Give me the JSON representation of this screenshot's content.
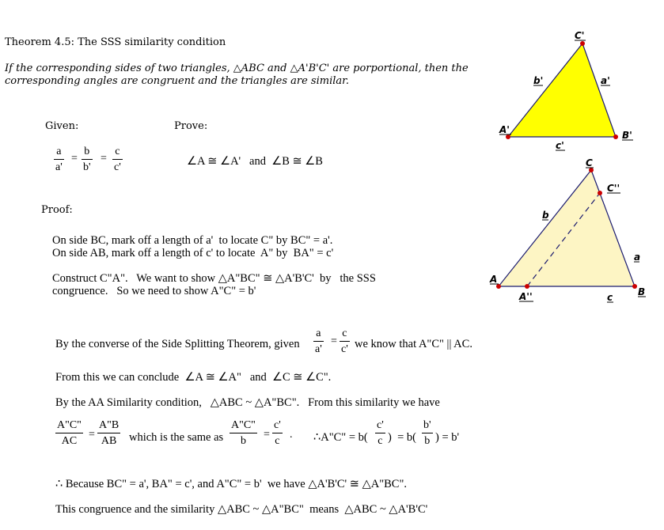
{
  "theorem": {
    "title": "Theorem 4.5: The SSS similarity condition",
    "statement_line1": "If the corresponding sides of two triangles, △ABC  and △A'B'C'  are porportional, then the",
    "statement_line2": "corresponding angles are congruent and the triangles are similar."
  },
  "given": {
    "label": "Given:",
    "fractions": [
      {
        "num": "a",
        "den": "a'"
      },
      {
        "num": "b",
        "den": "b'"
      },
      {
        "num": "c",
        "den": "c'"
      }
    ],
    "eq": "="
  },
  "prove": {
    "label": "Prove:",
    "statement": "∠A ≅ ∠A'   and  ∠B ≅ ∠B"
  },
  "proof": {
    "label": "Proof:",
    "line1": "On side BC, mark off a length of a'  to locate C\" by BC\" = a'.",
    "line2": "On side AB, mark off a length of c' to locate  A\" by  BA\" = c'",
    "line3": "Construct C\"A\".   We want to show △A\"BC\" ≅ △A'B'C'  by   the SSS",
    "line4": "congruence.   So we need to show A\"C\" = b'",
    "line5_pre": "By the converse of the Side Splitting Theorem, given",
    "line5_frac1": {
      "num": "a",
      "den": "a'"
    },
    "line5_frac2": {
      "num": "c",
      "den": "c'"
    },
    "line5_post": "we know that A\"C\" || AC.",
    "line6": "From this we can conclude  ∠A ≅ ∠A\"   and  ∠C ≅ ∠C\".",
    "line7": "By the AA Similarity condition,   △ABC ~ △A\"BC\".   From this similarity we have",
    "line8": {
      "frac1": {
        "num": "A\"C\"",
        "den": "AC"
      },
      "frac2": {
        "num": "A\"B",
        "den": "AB"
      },
      "mid_text": "which is the same as",
      "frac3": {
        "num": "A\"C\"",
        "den": "b"
      },
      "frac4": {
        "num": "c'",
        "den": "c"
      },
      "period": ".",
      "therefore_pre": "∴A\"C\" = b(",
      "frac5": {
        "num": "c'",
        "den": "c"
      },
      "mid2": ")  = b(",
      "frac6": {
        "num": "b'",
        "den": "b"
      },
      "end": ") = b'"
    },
    "line9": "∴ Because BC\" = a', BA\" = c', and A\"C\" = b'  we have △A'B'C' ≅ △A\"BC\".",
    "line10": "This congruence and the similarity △ABC ~ △A\"BC\"  means  △ABC ~ △A'B'C'"
  },
  "figure1": {
    "fill": "#ffff00",
    "stroke": "#1a1a6e",
    "point_color": "#cc0000",
    "labels": {
      "A": "A'",
      "B": "B'",
      "C": "C'",
      "a": "a'",
      "b": "b'",
      "c": "c'"
    }
  },
  "figure2": {
    "fill": "#fdf5c4",
    "stroke": "#1a1a6e",
    "point_color": "#cc0000",
    "labels": {
      "A": "A",
      "B": "B",
      "C": "C",
      "C2": "C''",
      "A2": "A''",
      "a": "a",
      "b": "b",
      "c": "c"
    }
  }
}
